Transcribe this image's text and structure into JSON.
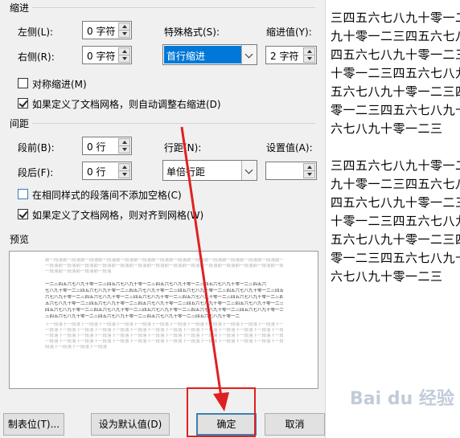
{
  "sections": {
    "indent": "缩进",
    "spacing": "间距",
    "preview": "预览"
  },
  "indent": {
    "left_label": "左侧(L):",
    "left_value": "0 字符",
    "right_label": "右侧(R):",
    "right_value": "0 字符",
    "special_label": "特殊格式(S):",
    "special_value": "首行缩进",
    "by_label": "缩进值(Y):",
    "by_value": "2 字符",
    "mirror_label": "对称缩进(M)",
    "mirror_checked": false,
    "auto_adjust_label": "如果定义了文档网格，则自动调整右缩进(D)",
    "auto_adjust_checked": true
  },
  "spacing": {
    "before_label": "段前(B):",
    "before_value": "0 行",
    "after_label": "段后(F):",
    "after_value": "0 行",
    "line_label": "行距(N):",
    "line_value": "单倍行距",
    "at_label": "设置值(A):",
    "at_value": "",
    "no_space_label": "在相同样式的段落间不添加空格(C)",
    "no_space_checked": false,
    "snap_grid_label": "如果定义了文档网格，则对齐到网格(W)",
    "snap_grid_checked": true
  },
  "preview": {
    "prev_lines": [
      "前一段落前一段落前一段落前一段落前一段落前一段落前一段落前一段落前一段落前一段落前一段落前一段落前一段落前一段落前一段落前",
      "一段落前一段落前一段落前一段落前一段落前一段落前一段落前一段落前一段落前一段落前一段落前一段落前一段落前一段落前一段落前",
      "一段落前一段落前一段落前一段落"
    ],
    "sample_lines": [
      "        一二三四五六七八九十零一二三四五六七八九十零一二三四五六七八九十零一二三四五六七八九十零一二三四五六",
      "七八九十零一二三四五六七八九十零一二三四五六七八九十零一二三四五六七八九十零一二三四五六七八九十零一二三四五",
      "六七八九十零一二三四五六七八九十零一二三四五六七八九十零一二三四五六七八九十零一二三四五六七八九十零一二三四",
      "五六七八九十零一二三四五六七八九十零一二三四五六七八九十零一二三四五六七八九十零一二三四五六七八九十零一二三",
      "四五六七八九十零一二三四五六七八九十零一二三四五六七八九十零一二三四五六七八九十零一二三四五六七八九十零一二",
      "三四五六七八九十零一二三四五六七八九十零一二三四五六七八九十零一二三四五六七八九十零一二"
    ],
    "next_lines": [
      "下一段落下一段落下一段落下一段落下一段落下一段落下一段落下一段落下一段落下一段落下一段落下一段落下一段落下一段落下一段落下",
      "一段落下一段落下一段落下一段落下一段落下一段落下一段落下一段落下一段落下一段落下一段落下一段落下一段落下一段落下一段落下",
      "一段落下一段落下一段落下一段落下一段落下一段落下一段落下一段落下一段落下一段落下一段落下一段落下一段落下一段落下一段落下",
      "一段落下一段落下一段落下一段落下一段落下一段落下一段落下一段落下一段落下一段落下一段落下一段落下一段落下一段落下一段落下",
      "段落下一段落下一段落下一段落"
    ]
  },
  "buttons": {
    "tabs": "制表位(T)...",
    "set_default": "设为默认值(D)",
    "ok": "确定",
    "cancel": "取消"
  },
  "document_lines": [
    "三四五六七八九十零一二",
    "九十零一二三四五六七八",
    "四五六七八九十零一二三",
    "十零一二三四五六七八九",
    "五六七八九十零一二三四",
    "零一二三四五六七八九十",
    "六七八九十零一二三",
    "",
    "三四五六七八九十零一二",
    "九十零一二三四五六七八",
    "四五六七八九十零一二三",
    "十零一二三四五六七八九",
    "五六七八九十零一二三四",
    "零一二三四五六七八九十",
    "六七八九十零一二三"
  ],
  "watermark": "Bai du 经验",
  "colors": {
    "selection": "#0078d7",
    "annotation": "#e02020"
  }
}
